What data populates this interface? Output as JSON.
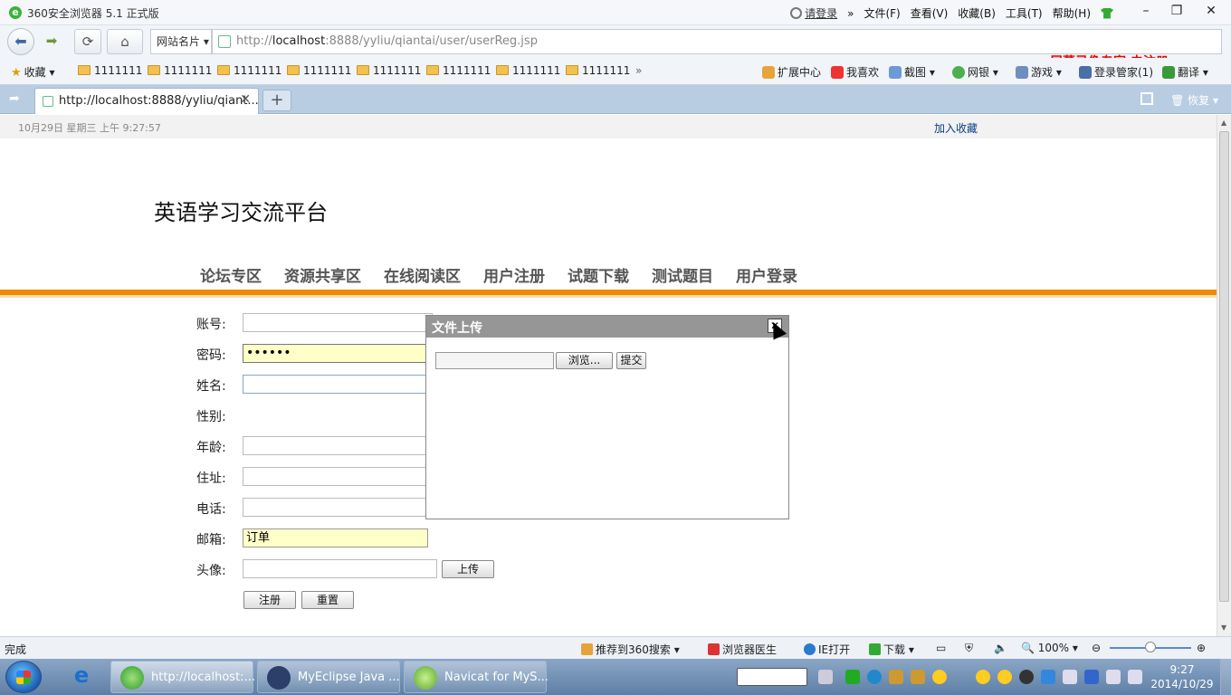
{
  "browser": {
    "window_title": "360安全浏览器 5.1 正式版",
    "login_link": "请登录",
    "menus": [
      "文件(F)",
      "查看(V)",
      "收藏(B)",
      "工具(T)",
      "帮助(H)"
    ],
    "site_name_dropdown": "网站名片",
    "url_prefix": "http://",
    "url_host": "localhost",
    "url_rest": ":8888/yyliu/qiantai/user/userReg.jsp",
    "watermark": "屏幕录像专家  未注册",
    "bookmarks_label": "收藏",
    "bookmark_folders": [
      "1111111",
      "1111111",
      "1111111",
      "1111111",
      "1111111",
      "1111111",
      "1111111",
      "1111111"
    ],
    "toolbar_items": [
      "扩展中心",
      "我喜欢",
      "截图",
      "网银",
      "游戏",
      "登录管家(1)",
      "翻译"
    ],
    "tab_title": "http://localhost:8888/yyliu/qiant...",
    "restore_label": "恢复",
    "status_text": "完成",
    "status_items": [
      "推荐到360搜索",
      "浏览器医生",
      "IE打开",
      "下载"
    ],
    "zoom": "100%"
  },
  "page": {
    "date": "10月29日  星期三  上午  9:27:57",
    "add_favorite": "加入收藏",
    "site_title": "英语学习交流平台",
    "nav": [
      "论坛专区",
      "资源共享区",
      "在线阅读区",
      "用户注册",
      "试题下载",
      "测试题目",
      "用户登录"
    ],
    "form": {
      "account_label": "账号:",
      "password_label": "密码:",
      "password_value": "••••••",
      "name_label": "姓名:",
      "gender_label": "性别:",
      "age_label": "年龄:",
      "address_label": "住址:",
      "phone_label": "电话:",
      "email_label": "邮箱:",
      "email_value": "订单",
      "avatar_label": "头像:",
      "upload_button": "上传",
      "register_button": "注册",
      "reset_button": "重置"
    },
    "dialog": {
      "title": "文件上传",
      "close": "✕",
      "browse_button": "浏览...",
      "submit_button": "提交"
    }
  },
  "taskbar": {
    "tasks": [
      "http://localhost:...",
      "MyEclipse Java ...",
      "Navicat for MyS..."
    ],
    "time": "9:27",
    "date": "2014/10/29"
  }
}
